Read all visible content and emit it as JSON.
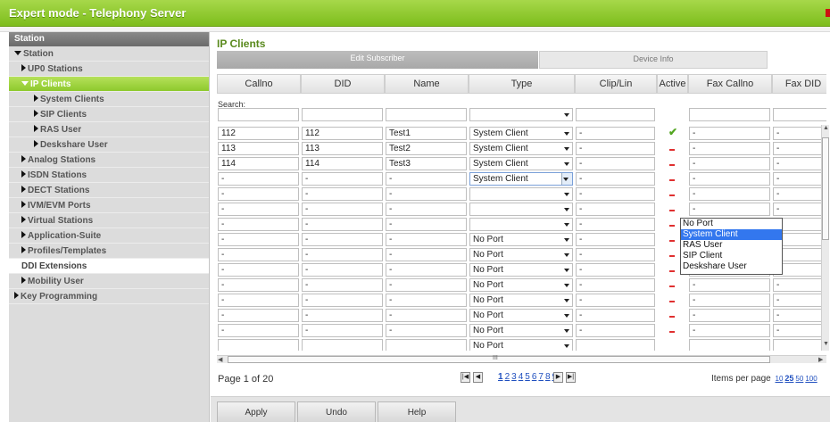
{
  "app": {
    "title": "Expert mode - Telephony Server"
  },
  "sidebar": {
    "header": "Station",
    "items": [
      {
        "label": "Station",
        "level": 0,
        "icon": "down"
      },
      {
        "label": "UP0 Stations",
        "level": 1,
        "icon": "right"
      },
      {
        "label": "IP Clients",
        "level": 1,
        "icon": "down",
        "active": true
      },
      {
        "label": "System Clients",
        "level": 2,
        "icon": "right"
      },
      {
        "label": "SIP Clients",
        "level": 2,
        "icon": "right"
      },
      {
        "label": "RAS User",
        "level": 2,
        "icon": "right"
      },
      {
        "label": "Deskshare User",
        "level": 2,
        "icon": "right"
      },
      {
        "label": "Analog Stations",
        "level": 1,
        "icon": "right"
      },
      {
        "label": "ISDN Stations",
        "level": 1,
        "icon": "right"
      },
      {
        "label": "DECT Stations",
        "level": 1,
        "icon": "right"
      },
      {
        "label": "IVM/EVM Ports",
        "level": 1,
        "icon": "right"
      },
      {
        "label": "Virtual Stations",
        "level": 1,
        "icon": "right"
      },
      {
        "label": "Application-Suite",
        "level": 1,
        "icon": "right"
      },
      {
        "label": "Profiles/Templates",
        "level": 1,
        "icon": "right"
      },
      {
        "label": "DDI Extensions",
        "level": 1,
        "icon": "none",
        "white": true
      },
      {
        "label": "Mobility User",
        "level": 1,
        "icon": "right"
      },
      {
        "label": "Key Programming",
        "level": 0,
        "icon": "right"
      }
    ]
  },
  "main": {
    "title": "IP Clients",
    "tabs": [
      "Edit Subscriber",
      "Device Info"
    ],
    "columns": [
      "Callno",
      "DID",
      "Name",
      "Type",
      "Clip/Lin",
      "Active",
      "Fax Callno",
      "Fax DID"
    ],
    "search_label": "Search:",
    "rows": [
      {
        "callno": "112",
        "did": "112",
        "name": "Test1",
        "type": "System Client",
        "clip": "-",
        "active": "check",
        "fax_callno": "-",
        "fax_did": "-"
      },
      {
        "callno": "113",
        "did": "113",
        "name": "Test2",
        "type": "System Client",
        "clip": "-",
        "active": "dash",
        "fax_callno": "-",
        "fax_did": "-"
      },
      {
        "callno": "114",
        "did": "114",
        "name": "Test3",
        "type": "System Client",
        "clip": "-",
        "active": "dash",
        "fax_callno": "-",
        "fax_did": "-"
      },
      {
        "callno": "-",
        "did": "-",
        "name": "-",
        "type": "System Client",
        "clip": "-",
        "active": "dash",
        "fax_callno": "-",
        "fax_did": "-"
      },
      {
        "callno": "-",
        "did": "-",
        "name": "-",
        "type": "",
        "clip": "-",
        "active": "dash",
        "fax_callno": "-",
        "fax_did": "-"
      },
      {
        "callno": "-",
        "did": "-",
        "name": "-",
        "type": "",
        "clip": "-",
        "active": "dash",
        "fax_callno": "-",
        "fax_did": "-"
      },
      {
        "callno": "-",
        "did": "-",
        "name": "-",
        "type": "",
        "clip": "-",
        "active": "dash",
        "fax_callno": "-",
        "fax_did": "-"
      },
      {
        "callno": "-",
        "did": "-",
        "name": "-",
        "type": "No Port",
        "clip": "-",
        "active": "dash",
        "fax_callno": "-",
        "fax_did": "-"
      },
      {
        "callno": "-",
        "did": "-",
        "name": "-",
        "type": "No Port",
        "clip": "-",
        "active": "dash",
        "fax_callno": "-",
        "fax_did": "-"
      },
      {
        "callno": "-",
        "did": "-",
        "name": "-",
        "type": "No Port",
        "clip": "-",
        "active": "dash",
        "fax_callno": "-",
        "fax_did": "-"
      },
      {
        "callno": "-",
        "did": "-",
        "name": "-",
        "type": "No Port",
        "clip": "-",
        "active": "dash",
        "fax_callno": "-",
        "fax_did": "-"
      },
      {
        "callno": "-",
        "did": "-",
        "name": "-",
        "type": "No Port",
        "clip": "-",
        "active": "dash",
        "fax_callno": "-",
        "fax_did": "-"
      },
      {
        "callno": "-",
        "did": "-",
        "name": "-",
        "type": "No Port",
        "clip": "-",
        "active": "dash",
        "fax_callno": "-",
        "fax_did": "-"
      },
      {
        "callno": "-",
        "did": "-",
        "name": "-",
        "type": "No Port",
        "clip": "-",
        "active": "dash",
        "fax_callno": "-",
        "fax_did": "-"
      },
      {
        "callno": "",
        "did": "",
        "name": "",
        "type": "No Port",
        "clip": "",
        "active": "",
        "fax_callno": "",
        "fax_did": ""
      }
    ],
    "dropdown": {
      "options": [
        "No Port",
        "System Client",
        "RAS User",
        "SIP Client",
        "Deskshare User"
      ],
      "highlighted": "System Client"
    },
    "scrollbar_thumb_label": "III",
    "pagination": {
      "page_text": "Page 1 of 20",
      "pages": [
        "1",
        "2",
        "3",
        "4",
        "5",
        "6",
        "7",
        "8",
        "9"
      ],
      "current": "1",
      "items_label": "Items per page",
      "per_page": [
        "10",
        "25",
        "50",
        "100"
      ],
      "per_page_current": "25"
    },
    "buttons": [
      "Apply",
      "Undo",
      "Help"
    ]
  },
  "colors": {
    "accent": "#8dc92d",
    "title_green": "#5a8a1e",
    "link": "#1f4fbf",
    "check": "#52a520",
    "inactive_dash": "#e03030"
  }
}
